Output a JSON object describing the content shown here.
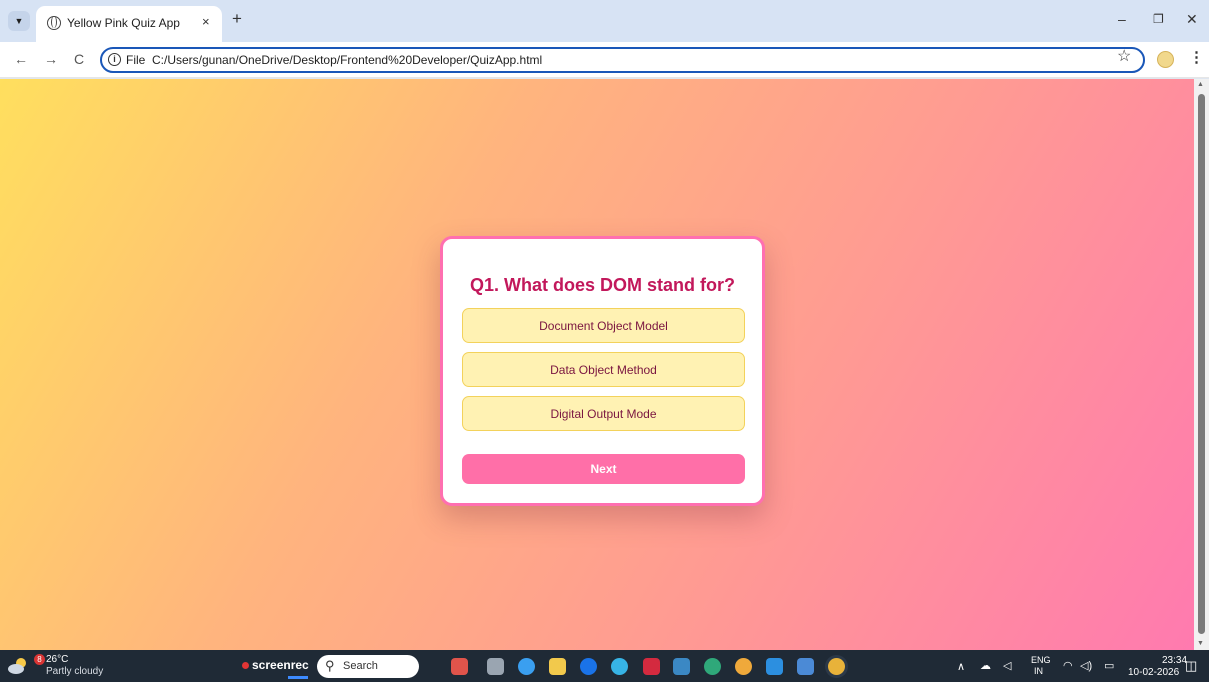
{
  "browser": {
    "tab_title": "Yellow Pink Quiz App",
    "tab_close": "×",
    "new_tab": "+",
    "url_scheme_label": "File",
    "url": "C:/Users/gunan/OneDrive/Desktop/Frontend%20Developer/QuizApp.html",
    "icons": {
      "tab_search": "chevron-down-icon",
      "favicon": "globe-icon",
      "back": "back-arrow-icon",
      "forward": "forward-arrow-icon",
      "reload": "reload-icon",
      "site_info": "info-icon",
      "bookmark": "star-icon",
      "profile": "profile-icon",
      "menu": "kebab-menu-icon",
      "minimize": "minimize-icon",
      "restore": "restore-icon",
      "close": "close-icon"
    }
  },
  "quiz": {
    "question": "Q1. What does DOM stand for?",
    "options": [
      "Document Object Model",
      "Data Object Method",
      "Digital Output Mode"
    ],
    "next_label": "Next",
    "colors": {
      "accent": "#c2185b",
      "option_bg": "#fff2b3",
      "next_bg": "#ff6fa8",
      "card_border": "#ff6fb0"
    }
  },
  "taskbar": {
    "weather": {
      "badge": "8",
      "temp": "26°C",
      "desc": "Partly cloudy"
    },
    "screenrec_label": "screenrec",
    "search_label": "Search",
    "lang_top": "ENG",
    "lang_bottom": "IN",
    "time": "23:34",
    "date": "10-02-2026",
    "apps": [
      "file-explorer-icon",
      "edge-icon",
      "folder-icon",
      "hp-icon",
      "copilot-icon",
      "mcafee-icon",
      "store-icon",
      "edge-beta-icon",
      "chrome-canary-icon",
      "vscode-icon",
      "app-icon",
      "chrome-icon"
    ]
  }
}
